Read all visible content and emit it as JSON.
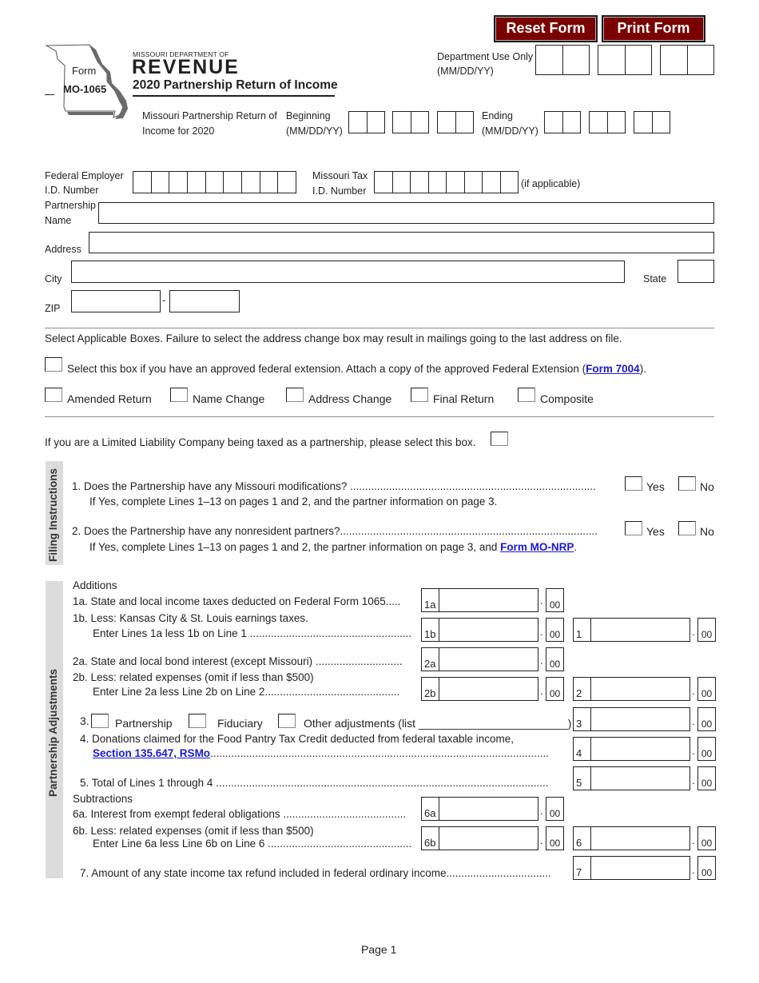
{
  "toolbar": {
    "reset_label": "Reset Form",
    "print_label": "Print Form"
  },
  "header": {
    "form_word": "Form",
    "form_number": "MO-1065",
    "dept_small": "MISSOURI DEPARTMENT OF",
    "dept_big": "REVENUE",
    "title": "2020 Partnership Return of Income",
    "subtitle_line1": "Missouri Partnership Return of",
    "subtitle_line2": "Income for 2020",
    "dept_use_line1": "Department Use Only",
    "dept_use_line2": "(MM/DD/YY)",
    "beginning_line1": "Beginning",
    "beginning_line2": "(MM/DD/YY)",
    "ending_line1": "Ending",
    "ending_line2": "(MM/DD/YY)"
  },
  "ids": {
    "fein_line1": "Federal Employer",
    "fein_line2": "I.D. Number",
    "motax_line1": "Missouri Tax",
    "motax_line2": "I.D. Number",
    "if_applicable": "(if applicable)"
  },
  "address": {
    "name_line1": "Partnership",
    "name_line2": "Name",
    "address_label": "Address",
    "city_label": "City",
    "state_label": "State",
    "zip_label": "ZIP",
    "zip_dash": "-",
    "name_value": "",
    "address_value": "",
    "city_value": "",
    "state_value": "",
    "zip_value": "",
    "zip4_value": ""
  },
  "applicable": {
    "instruction": "Select Applicable Boxes.  Failure to select the address change box may result in mailings going to the last address on file.",
    "extension_text": "Select this box if you have an approved federal extension.  Attach a copy of the approved Federal Extension (",
    "extension_link": "Form 7004",
    "extension_end": ").",
    "boxes": [
      "Amended Return",
      "Name Change",
      "Address Change",
      "Final Return",
      "Composite"
    ],
    "llc_text": "If you are a Limited Liability Company being taxed as a partnership, please select this box."
  },
  "filing": {
    "section_label": "Filing Instructions",
    "q1": "1.  Does the Partnership have any Missouri modifications? ..................................................................................",
    "q1_note": "If Yes, complete Lines 1–13 on pages 1 and 2, and the partner information on page 3.",
    "q2": "2.  Does the Partnership have any nonresident partners?......................................................................................",
    "q2_note": "If Yes, complete Lines 1–13 on pages 1 and 2, the partner information on page 3, and ",
    "q2_link": "Form MO-NRP",
    "q2_end": ".",
    "yes": "Yes",
    "no": "No"
  },
  "adjustments": {
    "section_label": "Partnership Adjustments",
    "additions": "Additions",
    "l1a": "1a. State and local income taxes deducted on Federal Form 1065.....",
    "l1b_1": "1b. Less: Kansas City & St. Louis earnings taxes.",
    "l1b_2": "Enter Lines 1a less 1b on Line 1 ......................................................",
    "l2a": "2a. State and local bond interest (except Missouri) .............................",
    "l2b_1": "2b. Less: related expenses (omit if less than $500)",
    "l2b_2": "Enter Line 2a less Line 2b on Line 2.............................................",
    "l3_num": "3.",
    "l3_opts": [
      "Partnership",
      "Fiduciary",
      "Other adjustments (list ________________________)"
    ],
    "l4_1": "4. Donations claimed for the Food Pantry Tax Credit deducted from federal taxable income,",
    "l4_link": "Section 135.647, RSMo",
    "l4_dots": ".................................................................................................................",
    "l5": "5. Total of Lines 1 through 4 ...............................................................................................................",
    "subtractions": "Subtractions",
    "l6a": "6a. Interest from exempt federal obligations .........................................",
    "l6b_1": "6b. Less: related expenses (omit if less than $500)",
    "l6b_2": "Enter Line 6a less Line 6b on Line 6 ................................................",
    "l7": "7. Amount of any state income tax refund included in federal ordinary income...................................",
    "box_labels": {
      "b1a": "1a",
      "b1b": "1b",
      "b1": "1",
      "b2a": "2a",
      "b2b": "2b",
      "b2": "2",
      "b3": "3",
      "b4": "4",
      "b5": "5",
      "b6a": "6a",
      "b6b": "6b",
      "b6": "6",
      "b7": "7"
    },
    "cents": "00",
    "dot": "."
  },
  "footer": {
    "page": "Page 1"
  }
}
